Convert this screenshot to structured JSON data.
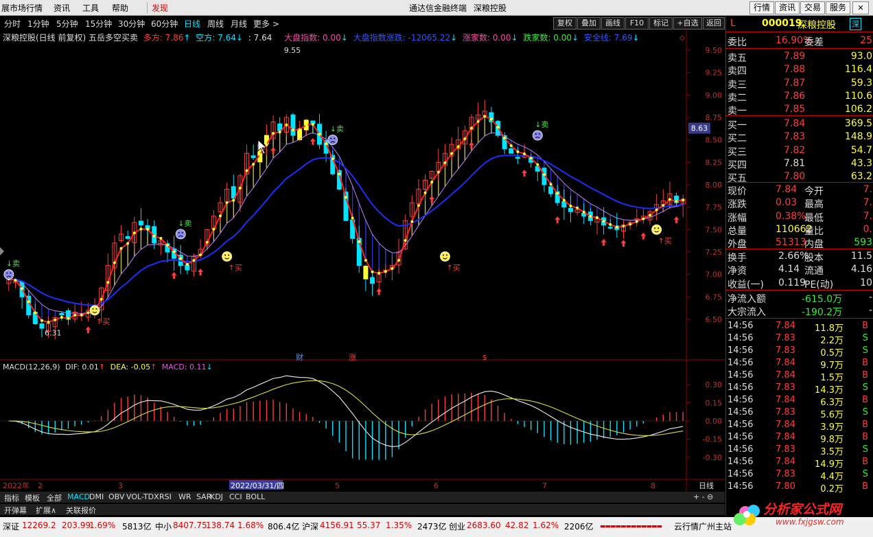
{
  "menu": {
    "items": [
      "展市场行情",
      "资讯",
      "工具",
      "帮助",
      "发现"
    ],
    "center": "通达信金融终端",
    "stock_title": "深粮控股",
    "right_buttons": [
      "行情",
      "资讯",
      "交易",
      "服务"
    ]
  },
  "timeframes": [
    "分时",
    "1分钟",
    "5分钟",
    "15分钟",
    "30分钟",
    "60分钟",
    "日线",
    "周线",
    "月线",
    "更多 >"
  ],
  "toolbar": [
    "复权",
    "叠加",
    "画线",
    "F10",
    "标记",
    "+自选",
    "返回"
  ],
  "title": {
    "name": "深粮控股(日线 前复权) 五岳多空买卖",
    "duo": "多方: 7.86",
    "kong": "空方: 7.64",
    "third": ": 7.64",
    "dapan": "大盘指数: 0.00",
    "dapan_zd": "大盘指数涨跌: -12065.22",
    "zjs": "涨家数: 0.00",
    "djs": "跌家数: 0.00",
    "aqx": "安全线: 7.69"
  },
  "chart_data": {
    "type": "candlestick",
    "price_ticks": [
      "9.50",
      "9.25",
      "9.00",
      "8.75",
      "8.50",
      "8.25",
      "8.00",
      "7.75",
      "7.50",
      "7.25",
      "7.00",
      "6.75",
      "6.50"
    ],
    "macd_ticks": [
      "0.30",
      "0.15",
      "0.00",
      "-0.15",
      "-0.30"
    ],
    "current_price_label": "8.63",
    "high_label": "9.55",
    "low_label": "6.31",
    "buy_label": "↑买",
    "sell_label": "↓卖",
    "events": [
      "财",
      "涨",
      "$"
    ],
    "date_labels": [
      "2022年",
      "2",
      "3",
      "2022/03/31/四",
      "5",
      "6",
      "7",
      "8"
    ],
    "highlight_date": "2022/03/31/四",
    "period_label": "日线",
    "closes": [
      6.95,
      6.92,
      6.75,
      6.55,
      6.45,
      6.4,
      6.45,
      6.52,
      6.55,
      6.5,
      6.58,
      6.55,
      6.6,
      6.62,
      6.85,
      7.1,
      7.35,
      7.45,
      7.4,
      7.58,
      7.55,
      7.5,
      7.35,
      7.38,
      7.25,
      7.18,
      7.1,
      7.05,
      7.2,
      7.28,
      7.5,
      7.65,
      7.8,
      7.95,
      7.85,
      8.1,
      8.35,
      8.3,
      8.45,
      8.55,
      8.7,
      8.6,
      8.75,
      8.55,
      8.62,
      8.72,
      8.68,
      8.45,
      8.35,
      8.12,
      7.95,
      7.6,
      7.4,
      7.1,
      6.95,
      6.9,
      7.0,
      7.05,
      7.1,
      7.25,
      7.6,
      7.8,
      7.95,
      8.05,
      8.15,
      8.25,
      8.35,
      8.45,
      8.5,
      8.6,
      8.75,
      8.78,
      8.82,
      8.7,
      8.55,
      8.4,
      8.35,
      8.3,
      8.32,
      8.25,
      8.15,
      8.0,
      7.9,
      7.8,
      7.75,
      7.7,
      7.72,
      7.65,
      7.6,
      7.62,
      7.55,
      7.52,
      7.5,
      7.55,
      7.58,
      7.62,
      7.65,
      7.7,
      7.78,
      7.82,
      7.9,
      7.8,
      7.84
    ]
  },
  "macd": {
    "label": "MACD(12,26,9)",
    "dif": "DIF: 0.01",
    "dea": "DEA: -0.05",
    "macd": "MACD: 0.11"
  },
  "bottom_tabs": [
    "指标",
    "模板",
    "全部",
    "MACD",
    "DMI",
    "OBV",
    "VOL-TDX",
    "RSI",
    "WR",
    "SAR",
    "KDJ",
    "CCI",
    "BOLL"
  ],
  "sub_tabs": [
    "开弹幕",
    "扩展∧",
    "关联报价"
  ],
  "status": {
    "sz": "深证",
    "sz_val": "12269.2",
    "sz_chg": "203.99",
    "sz_pct": "1.69%",
    "sz_amt": "5813亿",
    "zx": "中小",
    "zx_val": "8407.75",
    "zx_chg": "138.74",
    "zx_pct": "1.68%",
    "zx_amt": "806.4亿",
    "hs": "沪深",
    "hs_val": "4156.91",
    "hs_chg": "55.37",
    "hs_pct": "1.35%",
    "hs_amt": "2473亿",
    "cy": "创业",
    "cy_val": "2683.60",
    "cy_chg": "42.82",
    "cy_pct": "1.62%",
    "cy_amt": "2206亿",
    "cloud": "云行情广州主站"
  },
  "quote": {
    "flag": "L",
    "code": "000019",
    "name": "深粮控股",
    "exchange": "深",
    "webi_label": "委比",
    "webi": "16.90%",
    "weicha_label": "委差",
    "weicha": "25",
    "asks": [
      [
        "卖五",
        "7.89",
        "93.0"
      ],
      [
        "卖四",
        "7.88",
        "116.4"
      ],
      [
        "卖三",
        "7.87",
        "59.3"
      ],
      [
        "卖二",
        "7.86",
        "110.6"
      ],
      [
        "卖一",
        "7.85",
        "106.2"
      ]
    ],
    "bids": [
      [
        "买一",
        "7.84",
        "369.5"
      ],
      [
        "买二",
        "7.83",
        "148.9"
      ],
      [
        "买三",
        "7.82",
        "54.7"
      ],
      [
        "买四",
        "7.81",
        "43.3"
      ],
      [
        "买五",
        "7.80",
        "63.2"
      ]
    ],
    "stats": [
      [
        "现价",
        "7.84",
        "今开",
        "7."
      ],
      [
        "涨跌",
        "0.03",
        "最高",
        "7."
      ],
      [
        "涨幅",
        "0.38%",
        "最低",
        "7."
      ],
      [
        "总量",
        "110662",
        "量比",
        "0."
      ],
      [
        "外盘",
        "51313",
        "内盘",
        "593"
      ]
    ],
    "stats2": [
      [
        "换手",
        "2.66%",
        "股本",
        "11.5"
      ],
      [
        "净资",
        "4.14",
        "流通",
        "4.16"
      ],
      [
        "收益(一)",
        "0.119",
        "PE(动)",
        "10"
      ]
    ],
    "flow": [
      [
        "净流入额",
        "-615.0万",
        "-"
      ],
      [
        "大宗流入",
        "-190.2万",
        "-"
      ]
    ],
    "ticks": [
      [
        "14:56",
        "7.84",
        "11.8万",
        "B"
      ],
      [
        "14:56",
        "7.83",
        "2.2万",
        "S"
      ],
      [
        "14:56",
        "7.83",
        "0.5万",
        "S"
      ],
      [
        "14:56",
        "7.84",
        "9.7万",
        "B"
      ],
      [
        "14:56",
        "7.84",
        "1.5万",
        "B"
      ],
      [
        "14:56",
        "7.83",
        "14.3万",
        "S"
      ],
      [
        "14:56",
        "7.84",
        "6.3万",
        "B"
      ],
      [
        "14:56",
        "7.83",
        "5.6万",
        "S"
      ],
      [
        "14:56",
        "7.84",
        "3.9万",
        "B"
      ],
      [
        "14:56",
        "7.84",
        "9.8万",
        "B"
      ],
      [
        "14:56",
        "7.83",
        "3.5万",
        "S"
      ],
      [
        "14:56",
        "7.84",
        "14.9万",
        "B"
      ],
      [
        "14:56",
        "7.83",
        "4.4万",
        "S"
      ],
      [
        "14:56",
        "7.80",
        "0.2万",
        "B"
      ]
    ]
  },
  "logo": {
    "text": "分析家公式网",
    "url": "www.fxjgsw.com"
  },
  "colors": {
    "up": "#ff3c3c",
    "down": "#00e4ff",
    "yellow": "#ffff33",
    "blue": "#1a2fff",
    "purple": "#c080ff"
  }
}
